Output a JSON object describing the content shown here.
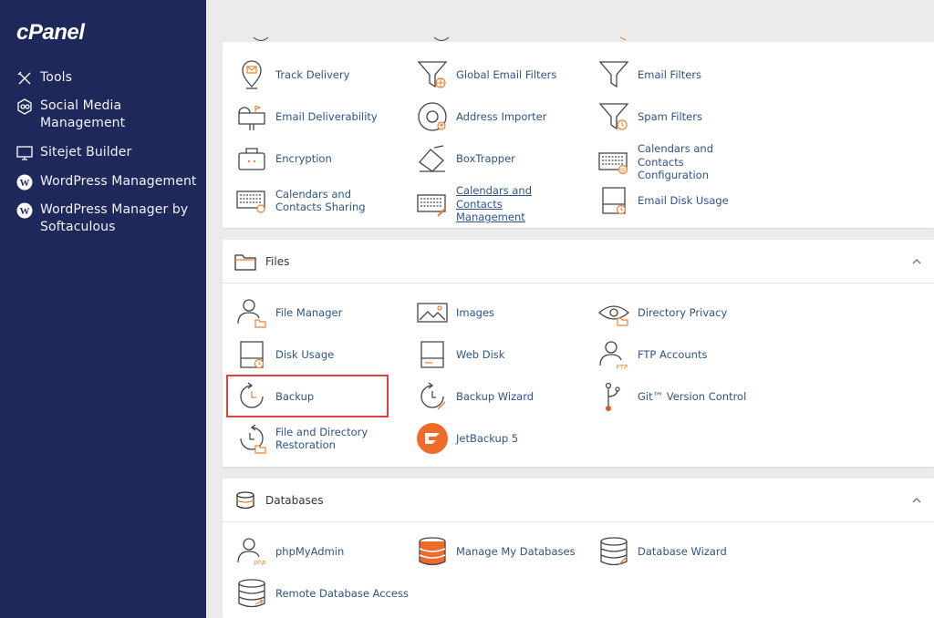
{
  "app": {
    "logo": "cPanel"
  },
  "sidebar": {
    "items": [
      {
        "label": "Tools",
        "icon": "tools-icon"
      },
      {
        "label": "Social Media Management",
        "icon": "social-media-icon"
      },
      {
        "label": "Sitejet Builder",
        "icon": "sitejet-icon"
      },
      {
        "label": "WordPress Management",
        "icon": "wordpress-icon"
      },
      {
        "label": "WordPress Manager by Softaculous",
        "icon": "wordpress-icon"
      }
    ]
  },
  "email_section": {
    "tools": [
      {
        "label": "Track Delivery",
        "icon": "map-pin-icon"
      },
      {
        "label": "Global Email Filters",
        "icon": "funnel-globe-icon"
      },
      {
        "label": "Email Filters",
        "icon": "funnel-icon"
      },
      {
        "label": "Email Deliverability",
        "icon": "mailbox-icon"
      },
      {
        "label": "Address Importer",
        "icon": "at-sign-icon"
      },
      {
        "label": "Spam Filters",
        "icon": "funnel-clock-icon"
      },
      {
        "label": "Encryption",
        "icon": "lock-box-icon"
      },
      {
        "label": "BoxTrapper",
        "icon": "box-trap-icon"
      },
      {
        "label": "Calendars and Contacts Configuration",
        "icon": "keyboard-at-icon"
      },
      {
        "label": "Calendars and Contacts Sharing",
        "icon": "keyboard-gear-icon"
      },
      {
        "label": "Calendars and Contacts Management",
        "icon": "keyboard-pencil-icon"
      },
      {
        "label": "Email Disk Usage",
        "icon": "disk-clock-icon"
      }
    ]
  },
  "files_section": {
    "title": "Files",
    "tools": [
      {
        "label": "File Manager",
        "icon": "user-folder-icon"
      },
      {
        "label": "Images",
        "icon": "image-icon"
      },
      {
        "label": "Directory Privacy",
        "icon": "eye-folder-icon"
      },
      {
        "label": "Disk Usage",
        "icon": "disk-clock-icon"
      },
      {
        "label": "Web Disk",
        "icon": "disk-icon"
      },
      {
        "label": "FTP Accounts",
        "icon": "user-ftp-icon"
      },
      {
        "label": "Backup",
        "icon": "backup-clock-icon"
      },
      {
        "label": "Backup Wizard",
        "icon": "backup-wizard-icon"
      },
      {
        "label": "Git™ Version Control",
        "icon": "git-branch-icon"
      },
      {
        "label": "File and Directory Restoration",
        "icon": "restore-icon"
      },
      {
        "label": "JetBackup 5",
        "icon": "jetbackup-icon"
      }
    ]
  },
  "databases_section": {
    "title": "Databases",
    "tools": [
      {
        "label": "phpMyAdmin",
        "icon": "user-php-icon"
      },
      {
        "label": "Manage My Databases",
        "icon": "database-icon"
      },
      {
        "label": "Database Wizard",
        "icon": "database-wizard-icon"
      },
      {
        "label": "Remote Database Access",
        "icon": "database-remote-icon"
      }
    ]
  },
  "colors": {
    "sidebar_bg": "#1f285a",
    "link": "#2d5488",
    "accent_orange": "#f08030",
    "highlight": "#e0403e"
  }
}
